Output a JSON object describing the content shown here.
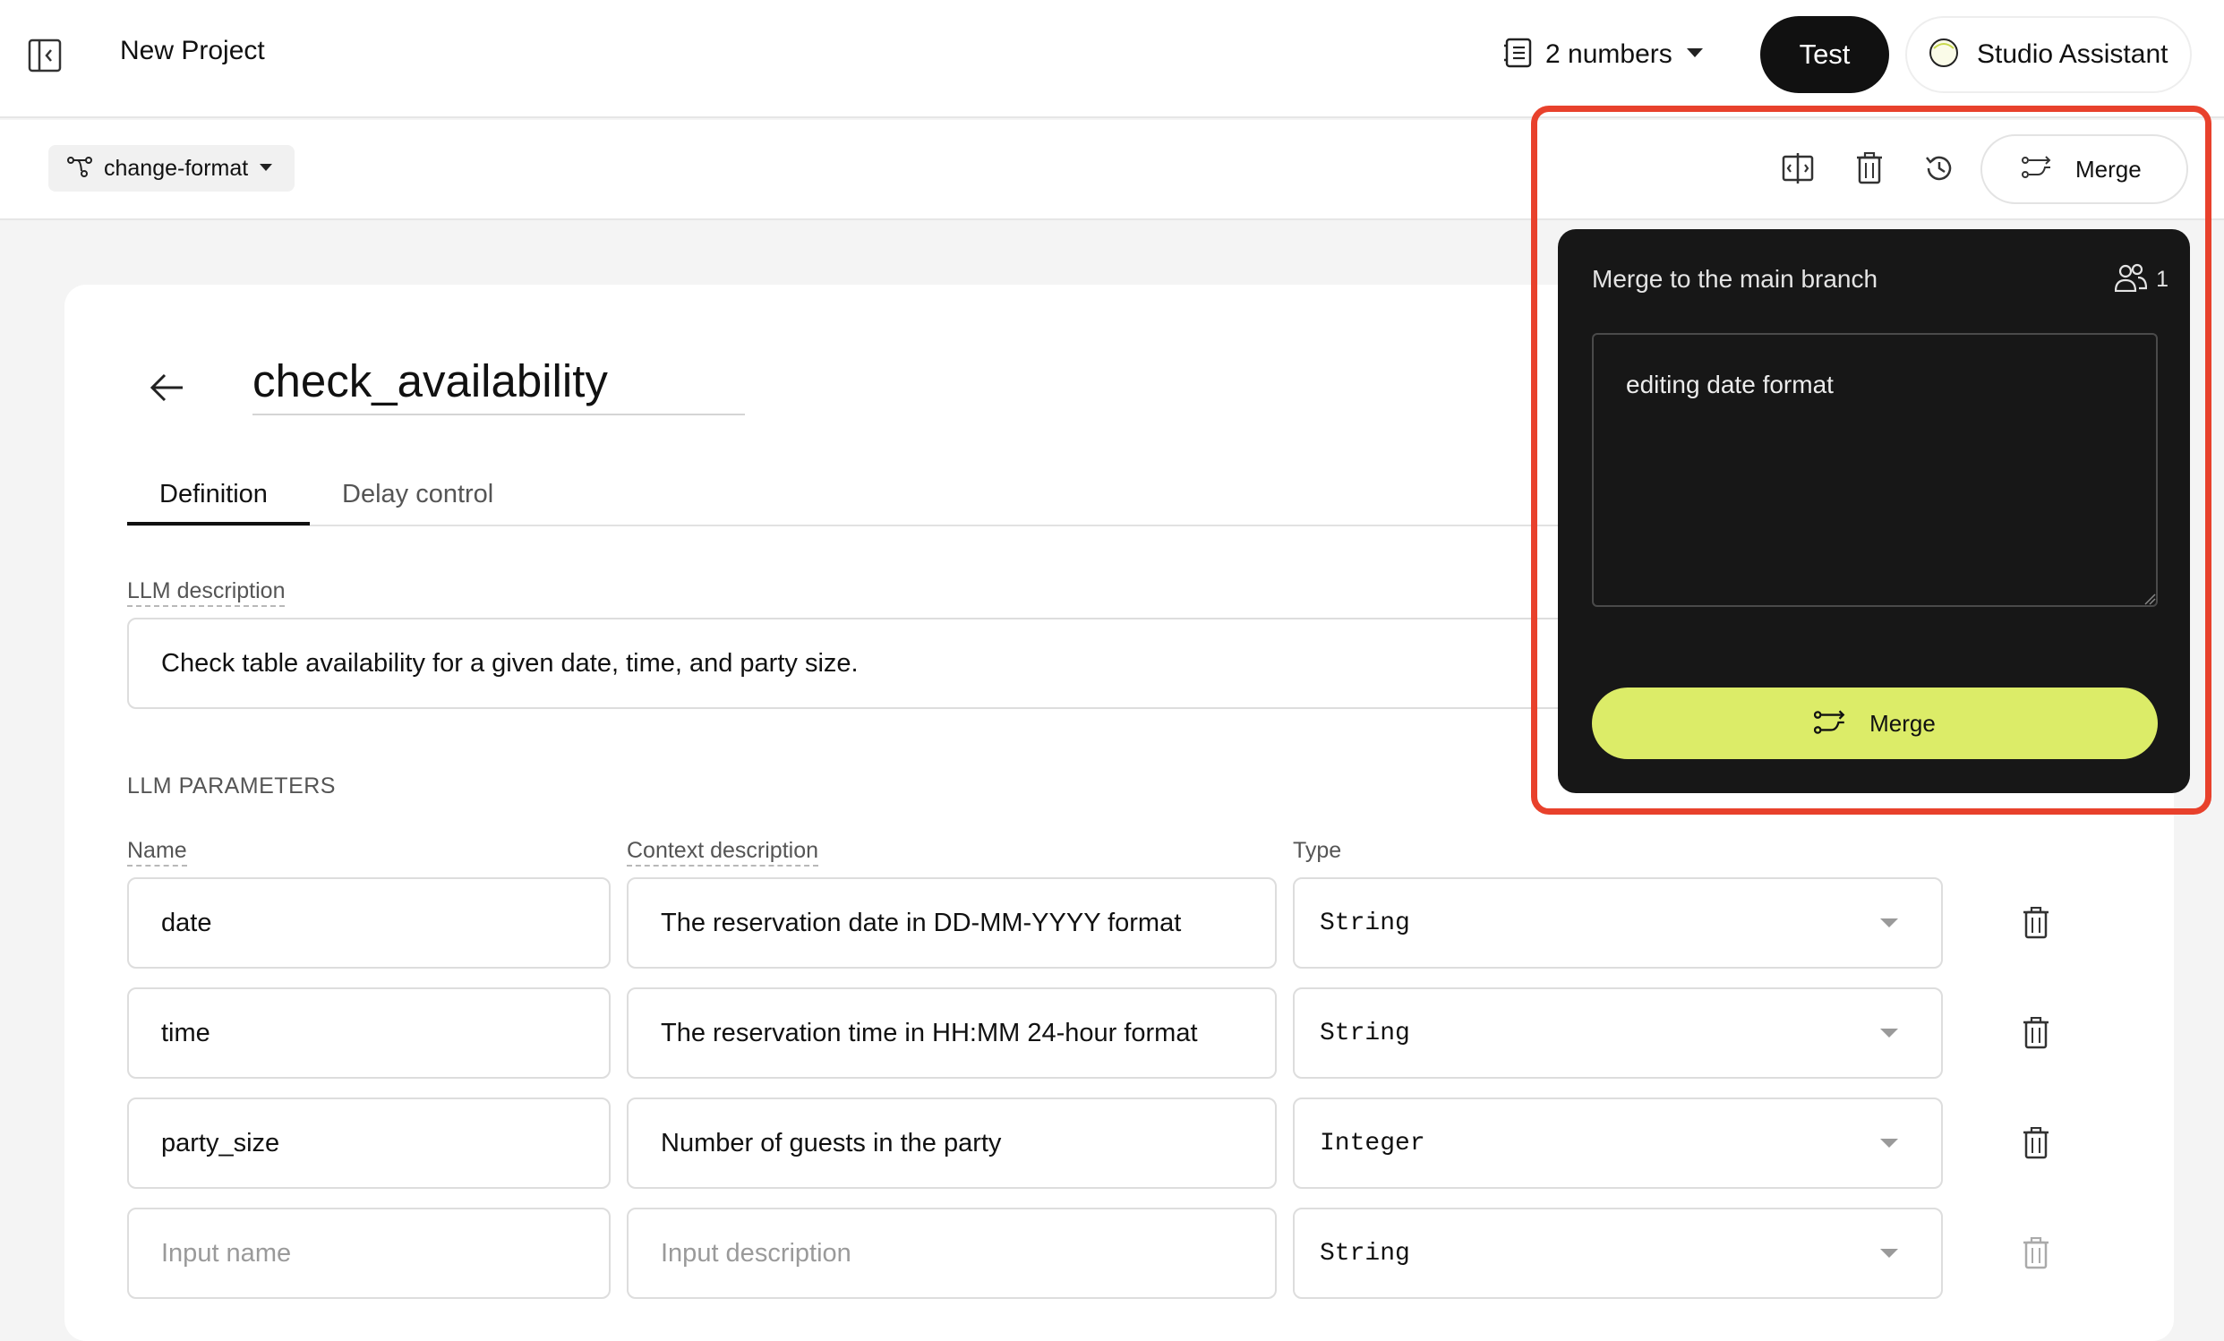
{
  "header": {
    "project_title": "New Project",
    "numbers_label": "2 numbers",
    "test_label": "Test",
    "assistant_label": "Studio Assistant"
  },
  "toolbar": {
    "branch_label": "change-format",
    "merge_label": "Merge"
  },
  "tool": {
    "title": "check_availability",
    "tabs": [
      {
        "label": "Definition",
        "active": true
      },
      {
        "label": "Delay control",
        "active": false
      }
    ],
    "llm_description_label": "LLM description",
    "llm_description": "Check table availability for a given date, time, and party size.",
    "params_heading": "LLM PARAMETERS",
    "columns": {
      "name": "Name",
      "context": "Context description",
      "type": "Type"
    },
    "params": [
      {
        "name": "date",
        "description": "The reservation date in DD-MM-YYYY format",
        "type": "String"
      },
      {
        "name": "time",
        "description": "The reservation time in HH:MM 24-hour format",
        "type": "String"
      },
      {
        "name": "party_size",
        "description": "Number of guests in the party",
        "type": "Integer"
      }
    ],
    "new_param": {
      "name_placeholder": "Input name",
      "description_placeholder": "Input description",
      "type": "String"
    }
  },
  "merge_popover": {
    "title": "Merge to the main branch",
    "user_count": "1",
    "message": "editing date format",
    "button_label": "Merge"
  },
  "colors": {
    "accent": "#dcec68",
    "highlight": "#e8412c",
    "popover_bg": "#171717",
    "primary_button": "#111111"
  },
  "icons": [
    "sidebar-toggle-icon",
    "phone-list-icon",
    "chevron-down-icon",
    "assistant-orb-icon",
    "branch-icon",
    "compare-icon",
    "trash-icon",
    "history-icon",
    "merge-icon",
    "back-arrow-icon",
    "users-icon"
  ]
}
